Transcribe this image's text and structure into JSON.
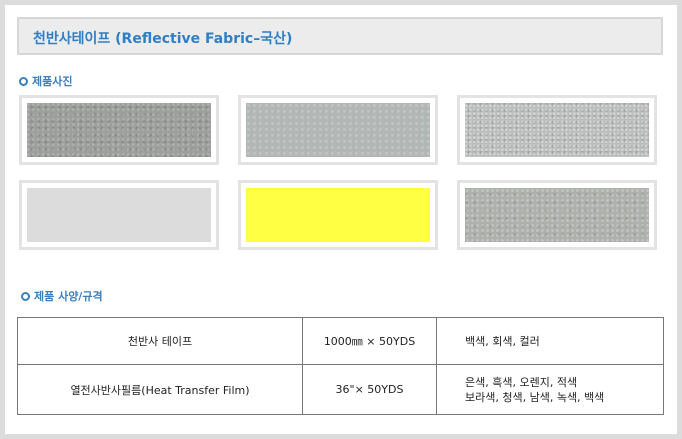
{
  "header": {
    "title": "천반사테이프 (Reflective Fabric–국산)"
  },
  "sections": {
    "photos_label": "제품사진",
    "spec_label": "제품 사양/규격"
  },
  "photos": [
    {
      "name": "swatch-gray-dark",
      "color": "#9d9f9d"
    },
    {
      "name": "swatch-gray-silver",
      "color": "#b2b6b5"
    },
    {
      "name": "swatch-gray-sparkle",
      "color": "#b9bcba"
    },
    {
      "name": "swatch-light-gray",
      "color": "#dcdcdc"
    },
    {
      "name": "swatch-yellow",
      "color": "#ffff44"
    },
    {
      "name": "swatch-gray-textured",
      "color": "#adb0ac"
    }
  ],
  "spec_table": {
    "rows": [
      {
        "name": "천반사 테이프",
        "size": "1000㎜ × 50YDS",
        "colors": [
          "백색, 회색, 컬러"
        ]
      },
      {
        "name": "열전사반사필름(Heat Transfer Film)",
        "size": "36\"× 50YDS",
        "colors": [
          "은색, 흑색, 오렌지, 적색",
          "보라색, 청색, 남색, 녹색, 백색"
        ]
      }
    ]
  },
  "colors": {
    "accent": "#2f7fc4",
    "background": "#dcdcdc",
    "border": "#777777"
  }
}
